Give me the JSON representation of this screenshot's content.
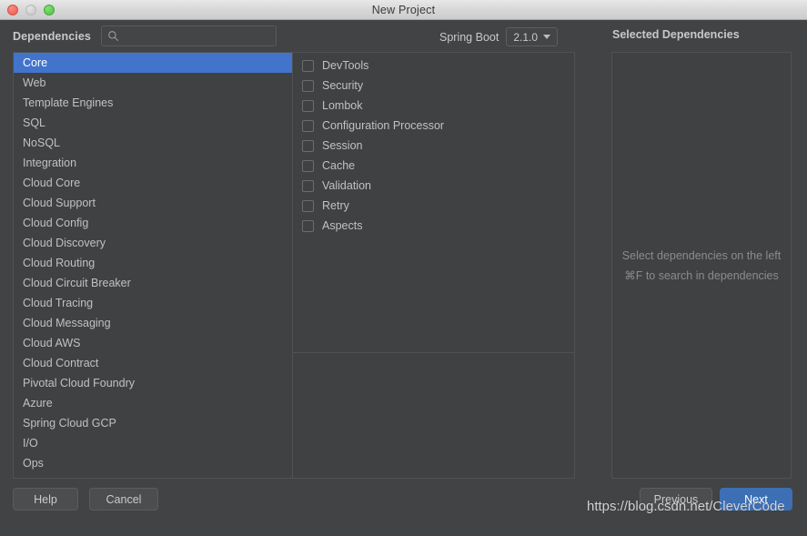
{
  "window": {
    "title": "New Project",
    "traffic_lights": [
      {
        "name": "close",
        "color": "#ed6a5f"
      },
      {
        "name": "minimize",
        "color": "#cfcfcf"
      },
      {
        "name": "maximize",
        "color": "#5ec94f"
      }
    ]
  },
  "header": {
    "dependencies_label": "Dependencies",
    "search": {
      "icon": "search-icon",
      "value": "",
      "placeholder": ""
    },
    "spring_boot": {
      "label": "Spring Boot",
      "selected_version": "2.1.0",
      "caret_icon": "chevron-down-icon"
    },
    "selected_dependencies_title": "Selected Dependencies"
  },
  "categories": {
    "selected": "Core",
    "items": [
      {
        "label": "Core",
        "selected": true
      },
      {
        "label": "Web",
        "selected": false
      },
      {
        "label": "Template Engines",
        "selected": false
      },
      {
        "label": "SQL",
        "selected": false
      },
      {
        "label": "NoSQL",
        "selected": false
      },
      {
        "label": "Integration",
        "selected": false
      },
      {
        "label": "Cloud Core",
        "selected": false
      },
      {
        "label": "Cloud Support",
        "selected": false
      },
      {
        "label": "Cloud Config",
        "selected": false
      },
      {
        "label": "Cloud Discovery",
        "selected": false
      },
      {
        "label": "Cloud Routing",
        "selected": false
      },
      {
        "label": "Cloud Circuit Breaker",
        "selected": false
      },
      {
        "label": "Cloud Tracing",
        "selected": false
      },
      {
        "label": "Cloud Messaging",
        "selected": false
      },
      {
        "label": "Cloud AWS",
        "selected": false
      },
      {
        "label": "Cloud Contract",
        "selected": false
      },
      {
        "label": "Pivotal Cloud Foundry",
        "selected": false
      },
      {
        "label": "Azure",
        "selected": false
      },
      {
        "label": "Spring Cloud GCP",
        "selected": false
      },
      {
        "label": "I/O",
        "selected": false
      },
      {
        "label": "Ops",
        "selected": false
      }
    ]
  },
  "dependencies": {
    "items": [
      {
        "label": "DevTools",
        "checked": false
      },
      {
        "label": "Security",
        "checked": false
      },
      {
        "label": "Lombok",
        "checked": false
      },
      {
        "label": "Configuration Processor",
        "checked": false
      },
      {
        "label": "Session",
        "checked": false
      },
      {
        "label": "Cache",
        "checked": false
      },
      {
        "label": "Validation",
        "checked": false
      },
      {
        "label": "Retry",
        "checked": false
      },
      {
        "label": "Aspects",
        "checked": false
      }
    ]
  },
  "selected_panel": {
    "hint_line_1": "Select dependencies on the left",
    "hint_line_2": "⌘F to search in dependencies",
    "selected_items": []
  },
  "footer": {
    "help_label": "Help",
    "cancel_label": "Cancel",
    "previous_label": "Previous",
    "next_label": "Next"
  },
  "watermark": {
    "text": "https://blog.csdn.net/CleverCode"
  },
  "colors": {
    "background": "#414345",
    "panel": "#3f4143",
    "border": "#4f5153",
    "selection_blue": "#4274cc",
    "primary_button_blue": "#3d6fb4",
    "text": "#c0c1c2",
    "muted_text": "#8a8c8e"
  }
}
